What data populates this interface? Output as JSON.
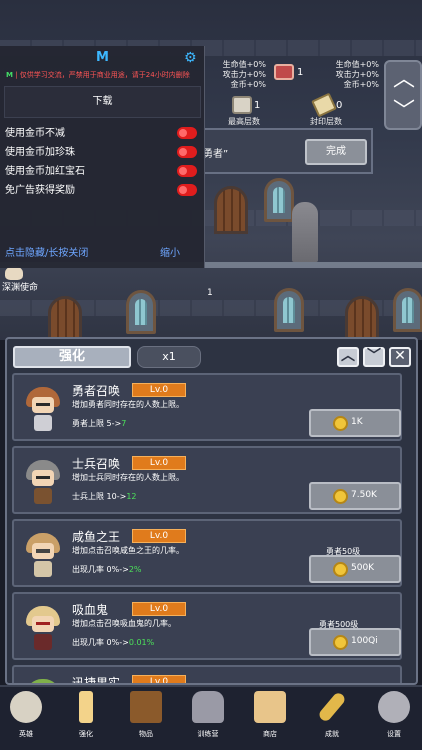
{
  "topbar": {
    "col1": [
      "生命值+0%",
      "攻击力+0%",
      "金币+0%"
    ],
    "gem_count": "1",
    "col2": [
      "生命值+0%",
      "攻击力+0%",
      "金币+0%"
    ],
    "chest_count": "1",
    "chest_label": "最高层数",
    "scroll_count": "0",
    "scroll_label": "封印层数"
  },
  "quest": {
    "text": "勇者”",
    "button": "完成"
  },
  "cheat_menu": {
    "title": "M",
    "notice_prefix": "M",
    "notice": "仅供学习交流，严禁用于商业用途，请于24小时内删除",
    "download": "下载",
    "options": [
      {
        "label": "使用金币不减"
      },
      {
        "label": "使用金币加珍珠"
      },
      {
        "label": "使用金币加红宝石"
      },
      {
        "label": "免广告获得奖励"
      }
    ],
    "hide_label": "点击隐藏/长按关闭",
    "minimize_label": "缩小"
  },
  "world": {
    "deep_label": "深渊使命",
    "floor_number": "1"
  },
  "panel": {
    "tab": "强化",
    "multiplier": "x1"
  },
  "upgrades": [
    {
      "name": "勇者召唤",
      "level": "Lv.0",
      "desc": "增加勇者同时存在的人数上限。",
      "stat": "勇者上限 5->",
      "next": "7",
      "req": "",
      "price": "1K"
    },
    {
      "name": "士兵召唤",
      "level": "Lv.0",
      "desc": "增加士兵同时存在的人数上限。",
      "stat": "士兵上限 10->",
      "next": "12",
      "req": "",
      "price": "7.50K"
    },
    {
      "name": "咸鱼之王",
      "level": "Lv.0",
      "desc": "增加点击召唤咸鱼之王的几率。",
      "stat": "出现几率 0%->",
      "next": "2%",
      "req": "勇者50级",
      "price": "500K"
    },
    {
      "name": "吸血鬼",
      "level": "Lv.0",
      "desc": "增加点击召唤吸血鬼的几率。",
      "stat": "出现几率 0%->",
      "next": "0.01%",
      "req": "勇者500级",
      "price": "100Qi"
    }
  ],
  "partial_upgrade": {
    "name": "迅捷果实",
    "level": "Lv.0"
  },
  "bottom_nav": [
    {
      "label": "英雄",
      "icon": "skull-icon",
      "color": "#d8d2c4"
    },
    {
      "label": "强化",
      "icon": "candle-icon",
      "color": "#f3d38a"
    },
    {
      "label": "物品",
      "icon": "book-icon",
      "color": "#8b5a2b"
    },
    {
      "label": "训练营",
      "icon": "lantern-icon",
      "color": "#9a9aa6"
    },
    {
      "label": "商店",
      "icon": "mug-icon",
      "color": "#e8c58a"
    },
    {
      "label": "成就",
      "icon": "key-icon",
      "color": "#e2b84a"
    },
    {
      "label": "设置",
      "icon": "gear-icon",
      "color": "#b0b0b8"
    }
  ]
}
